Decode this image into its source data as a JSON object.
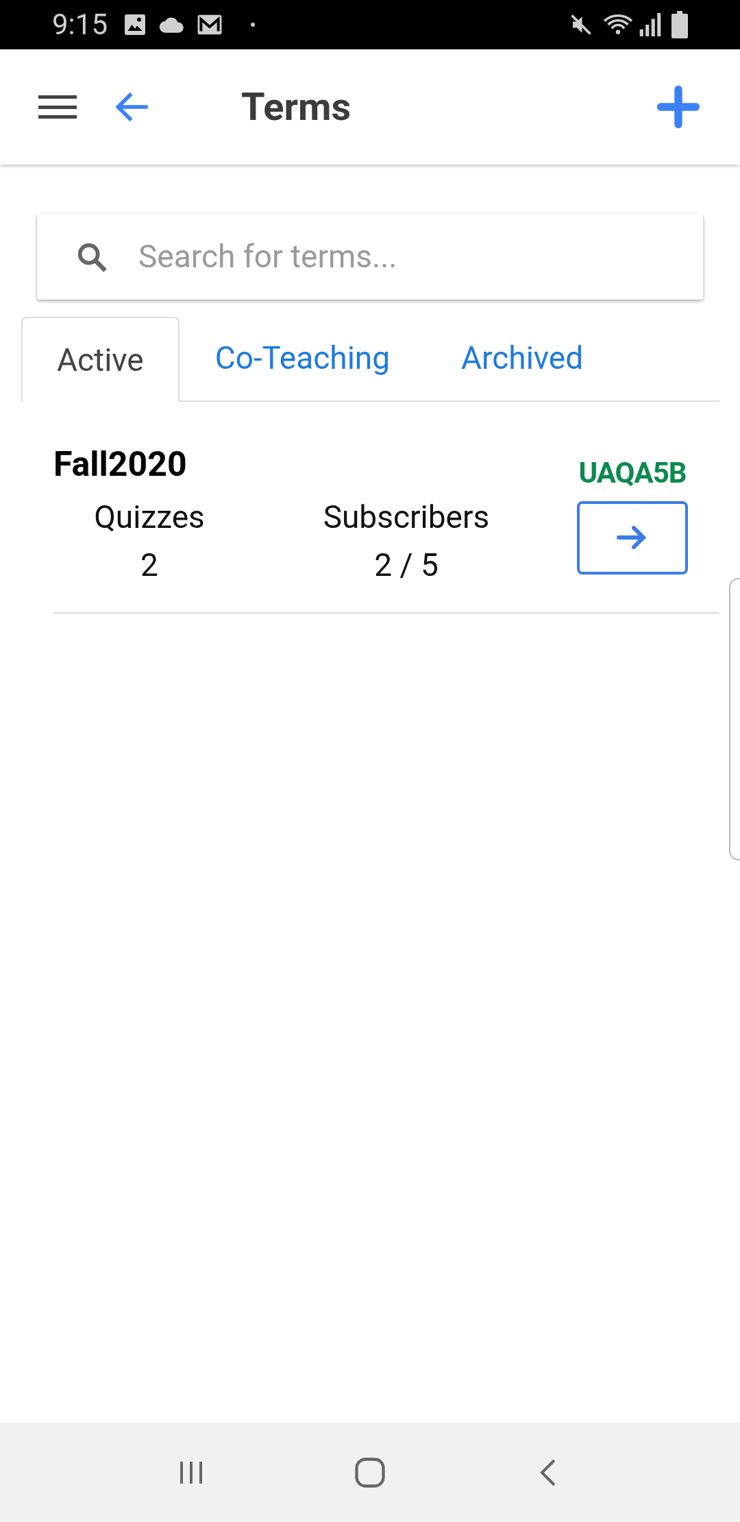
{
  "status_bar": {
    "time": "9:15"
  },
  "header": {
    "title": "Terms"
  },
  "search": {
    "placeholder": "Search for terms..."
  },
  "tabs": [
    {
      "label": "Active",
      "selected": true
    },
    {
      "label": "Co-Teaching",
      "selected": false
    },
    {
      "label": "Archived",
      "selected": false
    }
  ],
  "terms": [
    {
      "name": "Fall2020",
      "code": "UAQA5B",
      "stats": [
        {
          "label": "Quizzes",
          "value": "2"
        },
        {
          "label": "Subscribers",
          "value": "2 / 5"
        }
      ]
    }
  ]
}
